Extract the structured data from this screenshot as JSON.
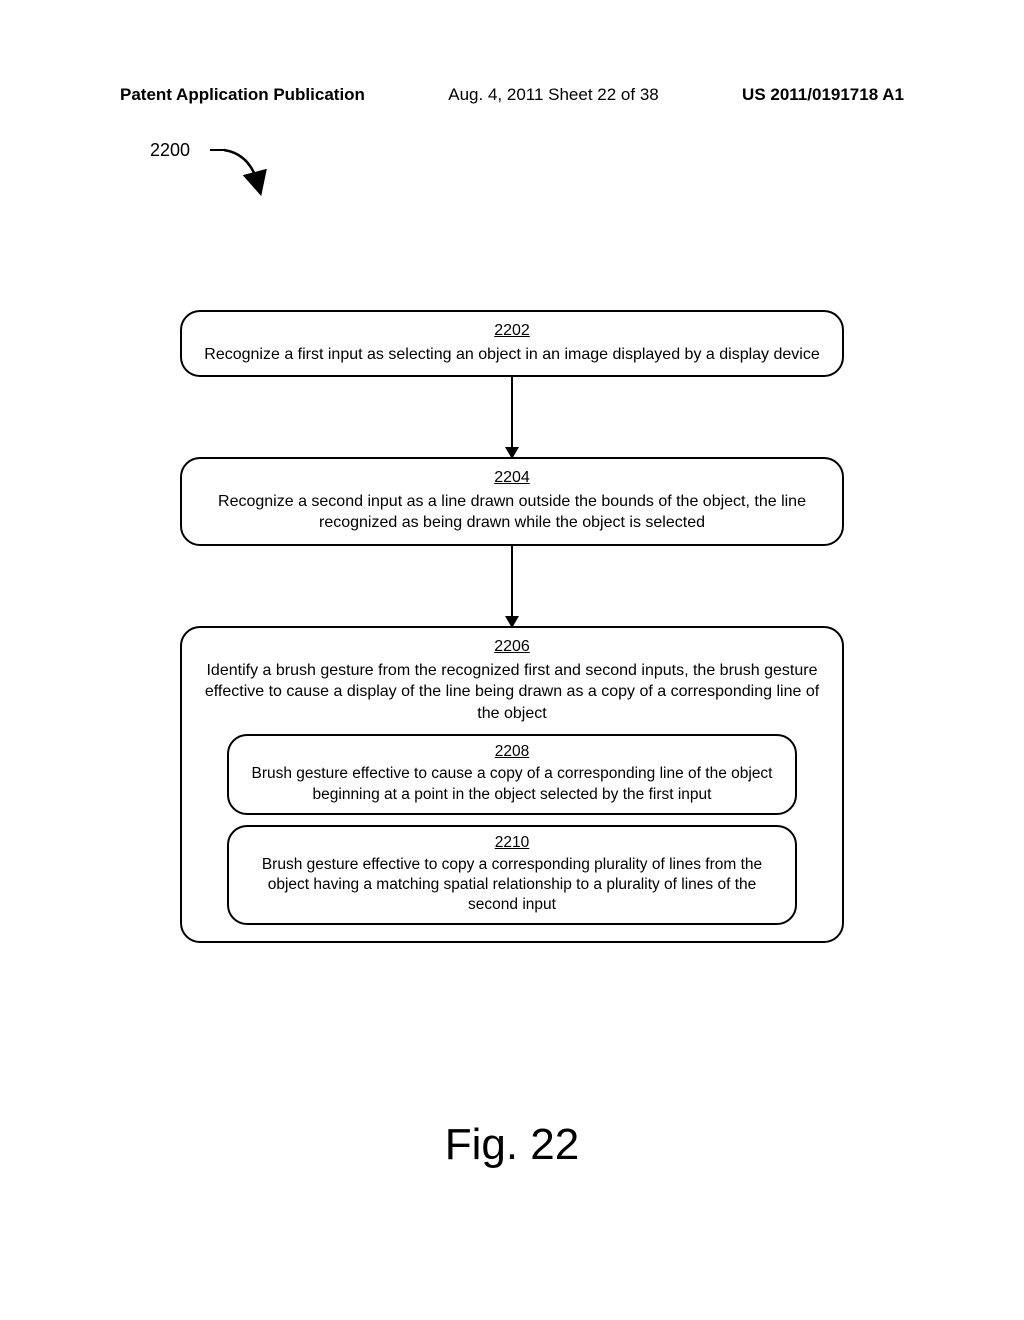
{
  "header": {
    "left": "Patent Application Publication",
    "mid": "Aug. 4, 2011   Sheet 22 of 38",
    "right": "US 2011/0191718 A1"
  },
  "ref_number": "2200",
  "steps": {
    "s2202": {
      "num": "2202",
      "text": "Recognize a first input as selecting an object in an image displayed by a display device"
    },
    "s2204": {
      "num": "2204",
      "text": "Recognize a second input as a line drawn outside the bounds of the object, the line recognized as being drawn while the object is selected"
    },
    "s2206": {
      "num": "2206",
      "text": "Identify a brush gesture from the recognized first and second inputs, the brush gesture effective to cause a display of the line being drawn as a copy of a corresponding line of the object"
    },
    "s2208": {
      "num": "2208",
      "text": "Brush gesture effective to cause a copy of a corresponding line of the object beginning at a point in the object selected by the first input"
    },
    "s2210": {
      "num": "2210",
      "text": "Brush gesture effective to copy a corresponding plurality of lines from the object having a matching spatial relationship to a plurality of lines of the second input"
    }
  },
  "figure_label": "Fig. 22"
}
